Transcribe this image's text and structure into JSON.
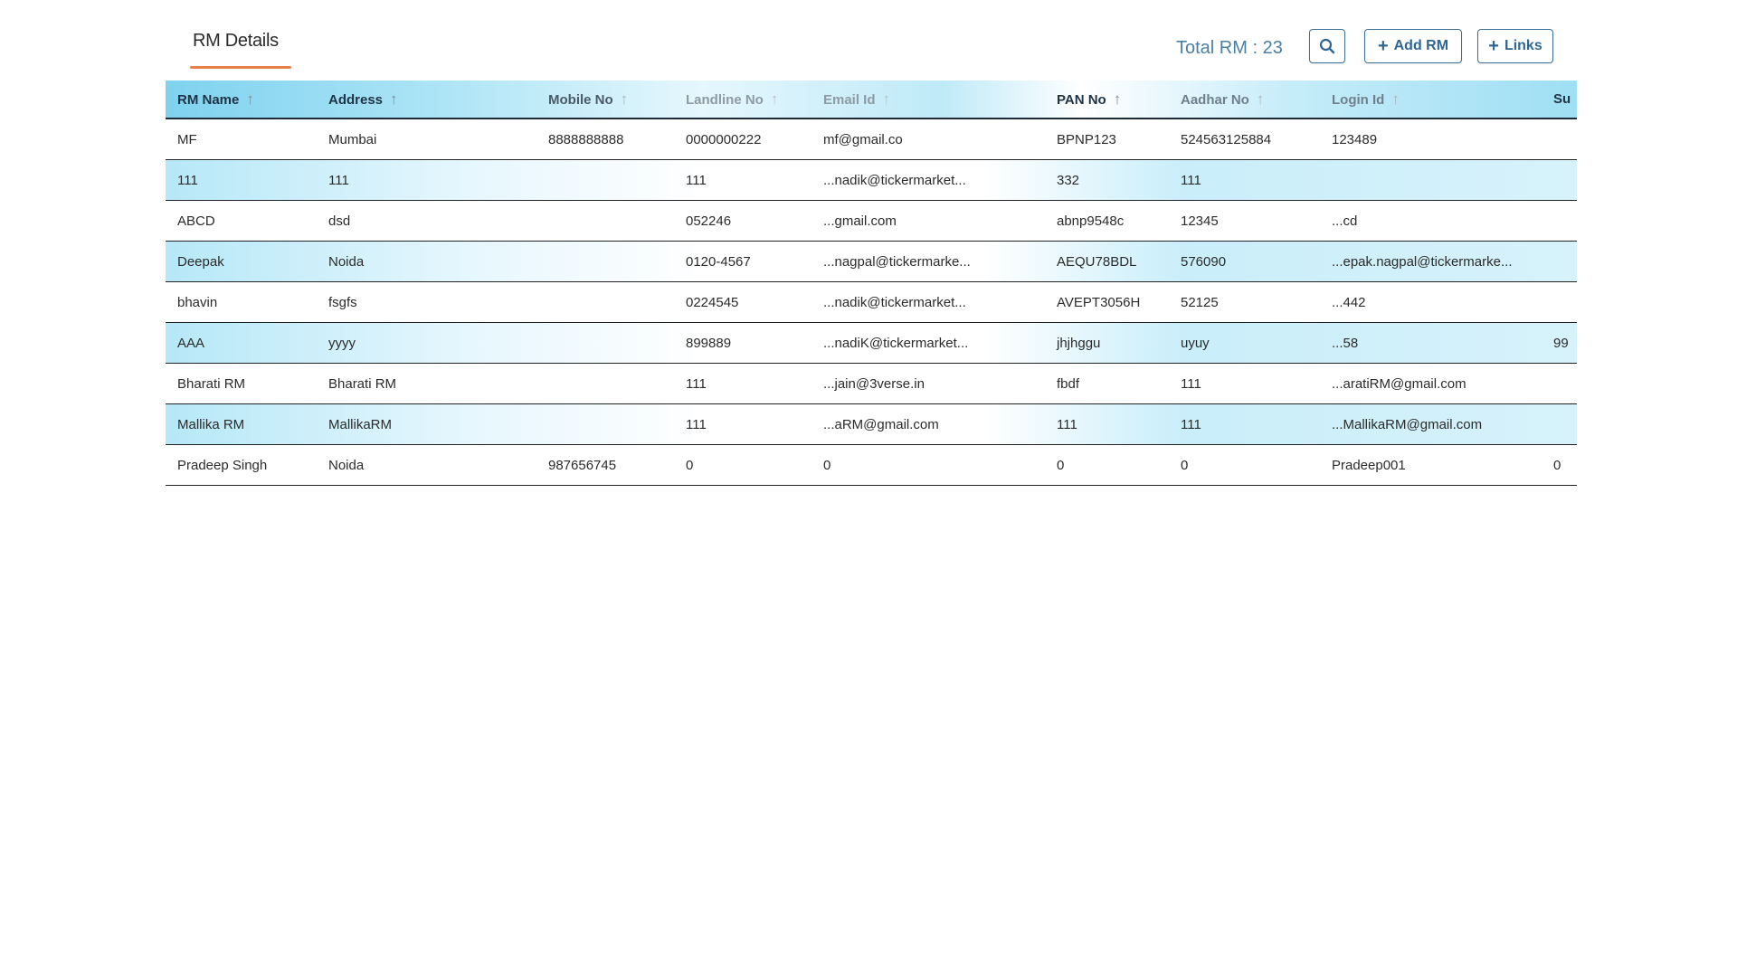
{
  "tab": {
    "label": "RM Details"
  },
  "header": {
    "total_label": "Total RM : 23",
    "search_icon": "search-icon",
    "add_label": "Add RM",
    "links_label": "Links"
  },
  "table": {
    "columns": [
      "RM Name",
      "Address",
      "Mobile No",
      "Landline No",
      "Email Id",
      "PAN No",
      "Aadhar No",
      "Login Id",
      "Su"
    ],
    "rows": [
      [
        "MF",
        "Mumbai",
        "8888888888",
        "0000000222",
        "mf@gmail.co",
        "BPNP123",
        "524563125884",
        "123489",
        ""
      ],
      [
        "111",
        "111",
        "",
        "111",
        "...nadik@tickermarket...",
        "332",
        "111",
        "",
        ""
      ],
      [
        "ABCD",
        "dsd",
        "",
        "052246",
        "...gmail.com",
        "abnp9548c",
        "12345",
        "...cd",
        ""
      ],
      [
        "Deepak",
        "Noida",
        "",
        "0120-4567",
        "...nagpal@tickermarke...",
        "AEQU78BDL",
        "576090",
        "...epak.nagpal@tickermarke...",
        ""
      ],
      [
        "bhavin",
        "fsgfs",
        "",
        "0224545",
        "...nadik@tickermarket...",
        "AVEPT3056H",
        "52125",
        "...442",
        ""
      ],
      [
        "AAA",
        "yyyy",
        "",
        "899889",
        "...nadiK@tickermarket...",
        "jhjhggu",
        "uyuy",
        "...58",
        "99"
      ],
      [
        "Bharati RM",
        "Bharati RM",
        "",
        "111",
        "...jain@3verse.in",
        "fbdf",
        "111",
        "...aratiRM@gmail.com",
        ""
      ],
      [
        "Mallika RM",
        "MallikaRM",
        "",
        "111",
        "...aRM@gmail.com",
        "111",
        "111",
        "...MallikaRM@gmail.com",
        ""
      ],
      [
        "Pradeep Singh",
        "Noida",
        "987656745",
        "0",
        "0",
        "0",
        "0",
        "Pradeep001",
        "0"
      ]
    ]
  }
}
